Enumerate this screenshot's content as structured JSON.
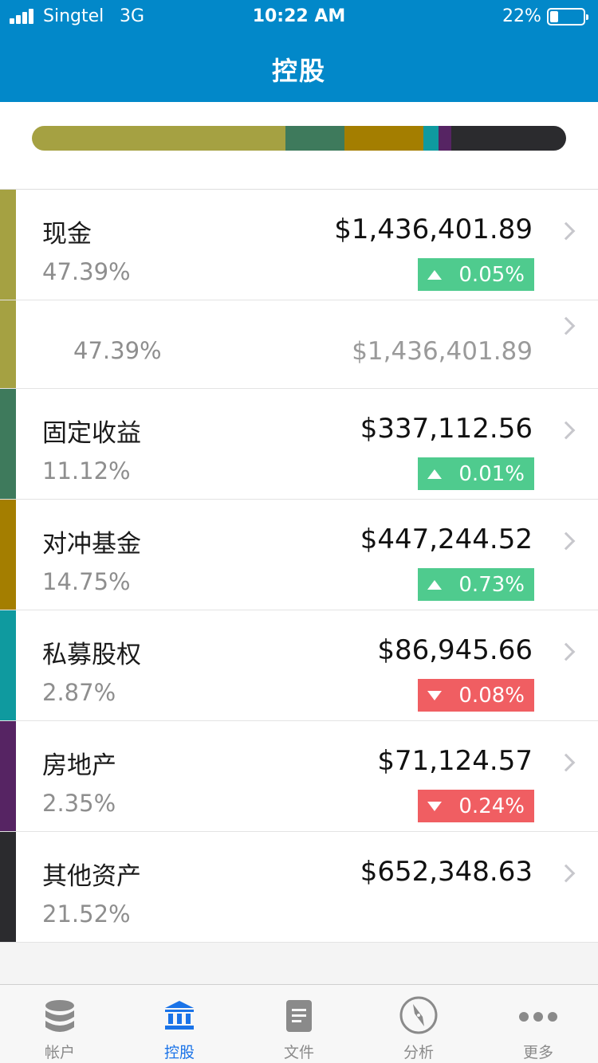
{
  "status": {
    "carrier": "Singtel",
    "network": "3G",
    "time": "10:22 AM",
    "battery_pct": "22%"
  },
  "header": {
    "title": "控股"
  },
  "allocation": [
    {
      "name": "现金",
      "fraction": 0.4739,
      "color": "#a5a142"
    },
    {
      "name": "固定收益",
      "fraction": 0.1112,
      "color": "#3e7a5c"
    },
    {
      "name": "对冲基金",
      "fraction": 0.1475,
      "color": "#a47e00"
    },
    {
      "name": "私募股权",
      "fraction": 0.0287,
      "color": "#0f9a9f"
    },
    {
      "name": "房地产",
      "fraction": 0.0235,
      "color": "#562463"
    },
    {
      "name": "其他资产",
      "fraction": 0.2152,
      "color": "#2b2b2e"
    }
  ],
  "holdings": [
    {
      "name": "现金",
      "pct": "47.39%",
      "amount": "$1,436,401.89",
      "change": "0.05%",
      "direction": "up",
      "color": "#a5a142"
    },
    {
      "sub": true,
      "pct": "47.39%",
      "amount": "$1,436,401.89",
      "color": "#a5a142"
    },
    {
      "name": "固定收益",
      "pct": "11.12%",
      "amount": "$337,112.56",
      "change": "0.01%",
      "direction": "up",
      "color": "#3e7a5c"
    },
    {
      "name": "对冲基金",
      "pct": "14.75%",
      "amount": "$447,244.52",
      "change": "0.73%",
      "direction": "up",
      "color": "#a47e00"
    },
    {
      "name": "私募股权",
      "pct": "2.87%",
      "amount": "$86,945.66",
      "change": "0.08%",
      "direction": "down",
      "color": "#0f9a9f"
    },
    {
      "name": "房地产",
      "pct": "2.35%",
      "amount": "$71,124.57",
      "change": "0.24%",
      "direction": "down",
      "color": "#562463"
    },
    {
      "name": "其他资产",
      "pct": "21.52%",
      "amount": "$652,348.63",
      "color": "#2b2b2e"
    }
  ],
  "tabs": [
    {
      "label": "帐户",
      "icon": "database-icon"
    },
    {
      "label": "控股",
      "icon": "bank-icon",
      "active": true
    },
    {
      "label": "文件",
      "icon": "document-icon"
    },
    {
      "label": "分析",
      "icon": "compass-icon"
    },
    {
      "label": "更多",
      "icon": "more-icon"
    }
  ]
}
